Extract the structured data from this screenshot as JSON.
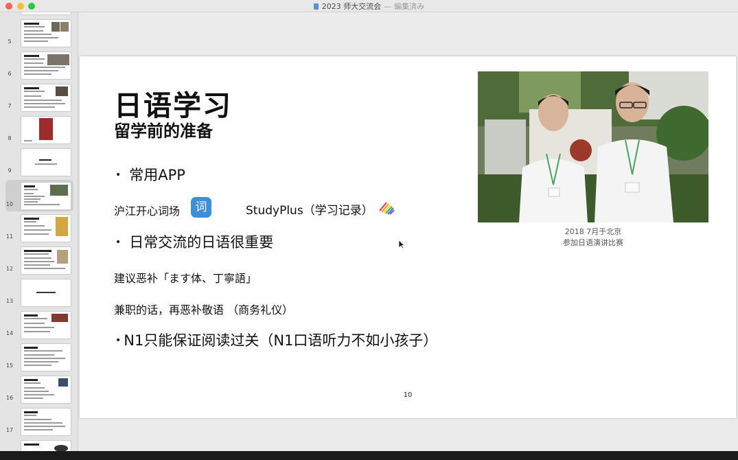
{
  "window": {
    "title": "2023 师大交流会",
    "separator": "—",
    "status": "編集済み"
  },
  "sidebar": {
    "slides": [
      {
        "number": "5"
      },
      {
        "number": "6"
      },
      {
        "number": "7"
      },
      {
        "number": "8"
      },
      {
        "number": "9"
      },
      {
        "number": "10",
        "selected": true
      },
      {
        "number": "11"
      },
      {
        "number": "12"
      },
      {
        "number": "13"
      },
      {
        "number": "14"
      },
      {
        "number": "15"
      },
      {
        "number": "16"
      },
      {
        "number": "17"
      }
    ]
  },
  "slide": {
    "title": "日语学习",
    "subtitle": "留学前的准备",
    "bullet1": "常用APP",
    "app1_label": "沪江开心词场",
    "app1_icon_char": "词",
    "app2_label": "StudyPlus（学习记录）",
    "bullet2": "日常交流的日语很重要",
    "line1": "建议恶补「ます体、丁寧語」",
    "line2": "兼职的话，再恶补敬语 （商务礼仪）",
    "bullet3": "N1只能保证阅读过关（N1口语听力不如小孩子）",
    "caption_line1": "2018 7月于北京",
    "caption_line2": "参加日语演讲比赛",
    "page_number": "10"
  },
  "colors": {
    "app1_icon_bg": "#3d8fd9",
    "traffic_close": "#fe5f57",
    "traffic_min": "#febc2e",
    "traffic_max": "#28c840"
  }
}
